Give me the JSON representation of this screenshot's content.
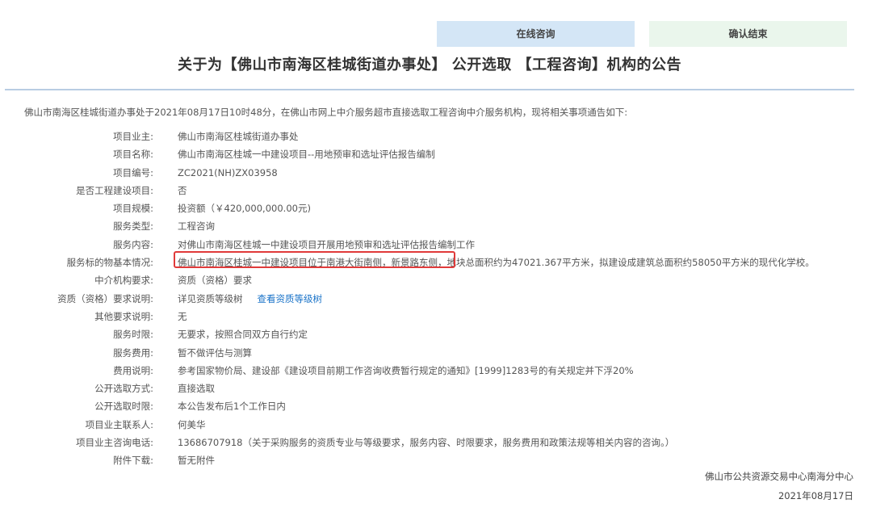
{
  "steps": {
    "active": "在线咨询",
    "pending": "确认结束"
  },
  "title": "关于为【佛山市南海区桂城街道办事处】 公开选取 【工程咨询】机构的公告",
  "intro": "佛山市南海区桂城街道办事处于2021年08月17日10时48分，在佛山市网上中介服务超市直接选取工程咨询中介服务机构，现将相关事项通告如下:",
  "rows": [
    {
      "label": "项目业主:",
      "value": "佛山市南海区桂城街道办事处"
    },
    {
      "label": "项目名称:",
      "value": "佛山市南海区桂城一中建设项目--用地预审和选址评估报告编制"
    },
    {
      "label": "项目编号:",
      "value": "ZC2021(NH)ZX03958"
    },
    {
      "label": "是否工程建设项目:",
      "value": "否"
    },
    {
      "label": "项目规模:",
      "value": "投资额（￥420,000,000.00元)"
    },
    {
      "label": "服务类型:",
      "value": "工程咨询"
    },
    {
      "label": "服务内容:",
      "value": "对佛山市南海区桂城一中建设项目开展用地预审和选址评估报告编制工作"
    },
    {
      "label": "服务标的物基本情况:",
      "value": "佛山市南海区桂城一中建设项目位于南港大街南侧，新景路东侧，地块总面积约为47021.367平方米，拟建设成建筑总面积约58050平方米的现代化学校。"
    },
    {
      "label": "中介机构要求:",
      "value": "资质（资格）要求"
    },
    {
      "label": "资质（资格）要求说明:",
      "value": "详见资质等级树",
      "link": "查看资质等级树"
    },
    {
      "label": "其他要求说明:",
      "value": "无"
    },
    {
      "label": "服务时限:",
      "value": "无要求，按照合同双方自行约定"
    },
    {
      "label": "服务费用:",
      "value": "暂不做评估与测算"
    },
    {
      "label": "费用说明:",
      "value": "参考国家物价局、建设部《建设项目前期工作咨询收费暂行规定的通知》[1999]1283号的有关规定并下浮20%"
    },
    {
      "label": "公开选取方式:",
      "value": "直接选取"
    },
    {
      "label": "公开选取时限:",
      "value": "本公告发布后1个工作日内"
    },
    {
      "label": "项目业主联系人:",
      "value": "何美华"
    },
    {
      "label": "项目业主咨询电话:",
      "value": "13686707918（关于采购服务的资质专业与等级要求，服务内容、时限要求，服务费用和政策法规等相关内容的咨询。）"
    },
    {
      "label": "附件下载:",
      "value": "暂无附件"
    }
  ],
  "footer": {
    "org": "佛山市公共资源交易中心南海分中心",
    "date": "2021年08月17日"
  },
  "colors": {
    "active_tab": "#d4e6f6",
    "pending_tab": "#eaf6ec",
    "divider": "#b8cde3",
    "link": "#1a73c8",
    "highlight": "#e03a3a"
  }
}
